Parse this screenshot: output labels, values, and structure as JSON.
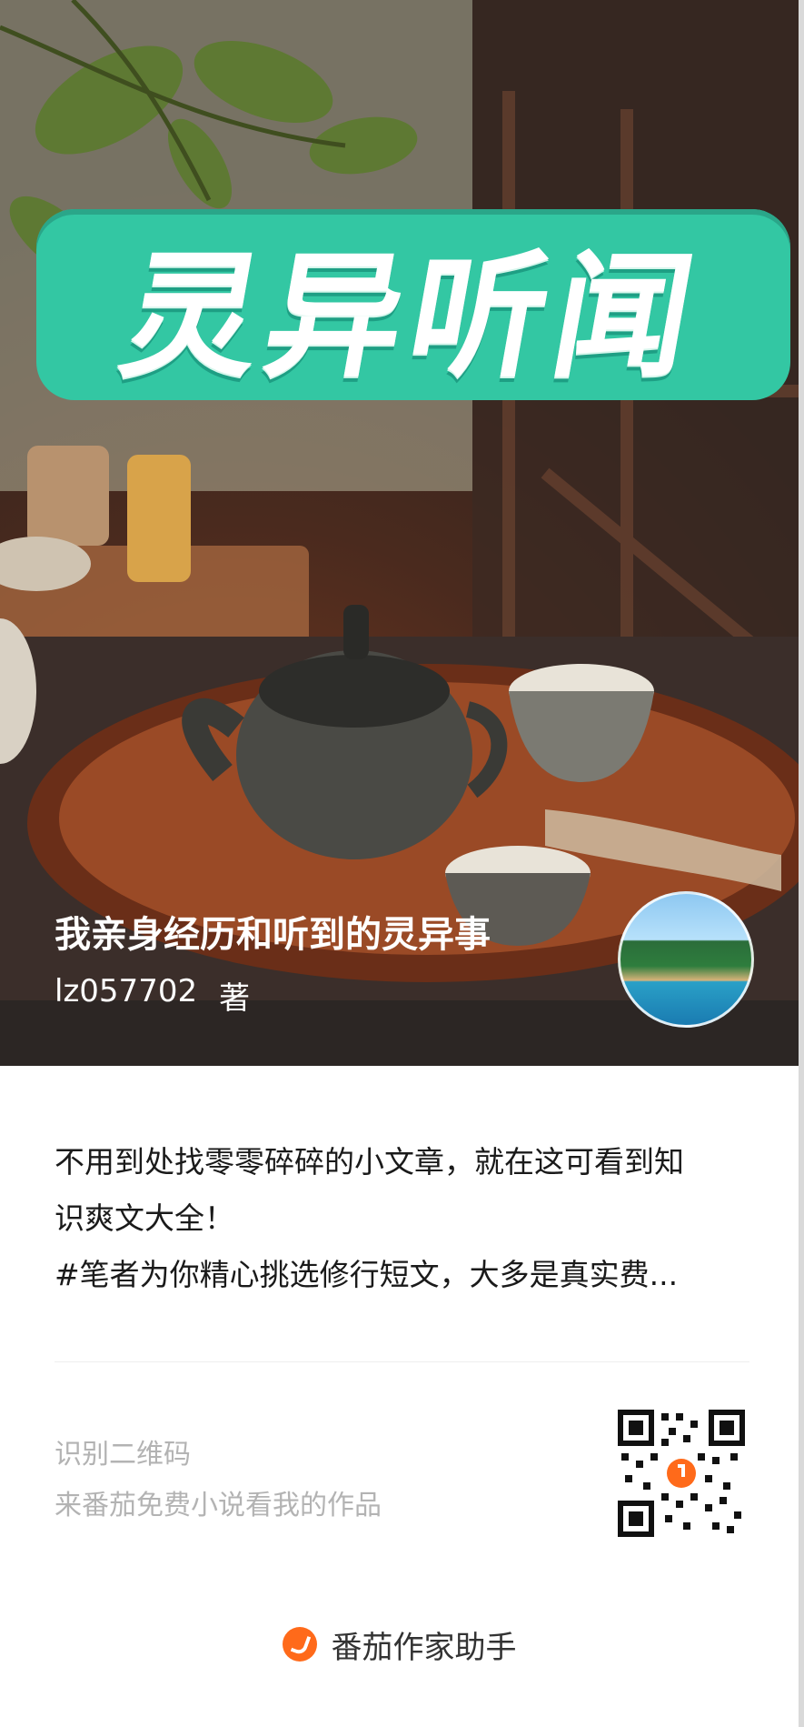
{
  "cover": {
    "title_art": "灵异听闻",
    "book_title": "我亲身经历和听到的灵异事",
    "author": "lz057702",
    "author_suffix": "著",
    "avatar_icon": "beach-coastline-avatar"
  },
  "description": {
    "line1": "不用到处找零零碎碎的小文章，就在这可看到知",
    "line2": "识爽文大全！",
    "line3": "#笔者为你精心挑选修行短文，大多是真实费..."
  },
  "qr_section": {
    "line1": "识别二维码",
    "line2": "来番茄免费小说看我的作品",
    "qr_icon": "qr-code-icon"
  },
  "footer": {
    "brand": "番茄作家助手",
    "brand_icon": "tomato-logo-icon",
    "brand_color": "#ff6a1a"
  },
  "colors": {
    "title_art_bg": "#33c7a3",
    "accent_orange": "#ff6a1a"
  }
}
